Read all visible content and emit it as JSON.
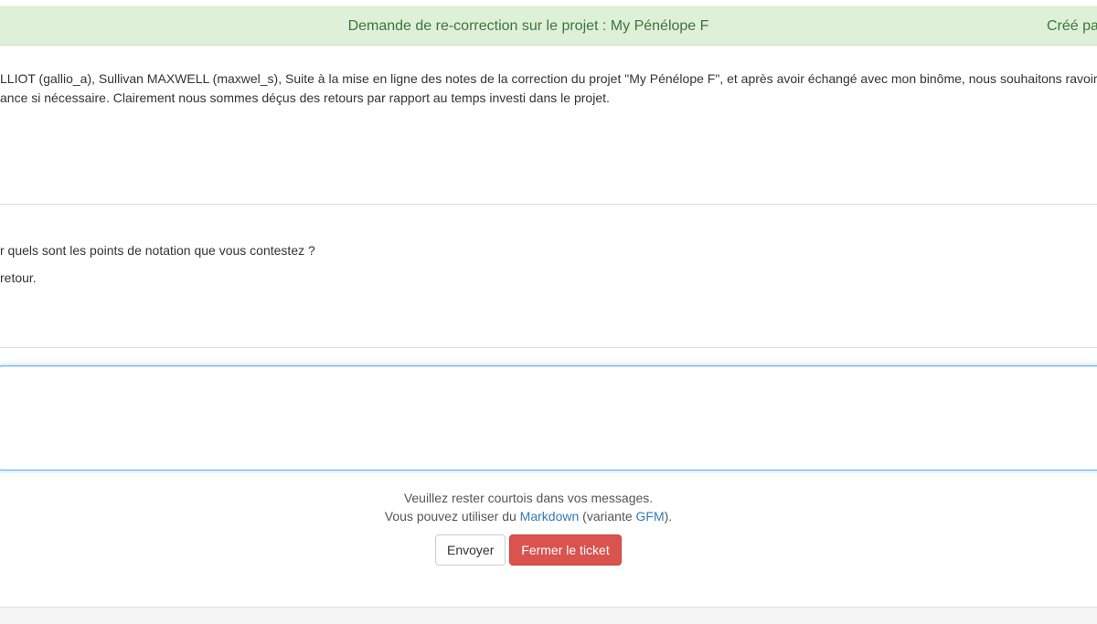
{
  "ticket": {
    "title": "Demande de re-correction sur le projet : My Pénélope F",
    "author_prefix": "Créé pa"
  },
  "messages": [
    {
      "line1": "LLIOT (gallio_a), Sullivan MAXWELL (maxwel_s), Suite à la mise en ligne des notes de la correction du projet \"My Pénélope F\", et après avoir échangé avec mon binôme, nous souhaitons ravoir",
      "line2": "ance si nécessaire. Clairement nous sommes déçus des retours par rapport au temps investi dans le projet."
    },
    {
      "line1": "r quels sont les points de notation que vous contestez ?",
      "line2": "retour."
    }
  ],
  "reply": {
    "value": "",
    "placeholder": ""
  },
  "hints": {
    "courtesy": "Veuillez rester courtois dans vos messages.",
    "markdown_prefix": "Vous pouvez utiliser du ",
    "markdown_link": "Markdown",
    "variant_prefix": " (variante ",
    "gfm_link": "GFM",
    "variant_suffix": ")."
  },
  "buttons": {
    "send": "Envoyer",
    "close": "Fermer le ticket"
  },
  "colors": {
    "header_bg": "#dff0d8",
    "header_text": "#3c763d",
    "link": "#337ab7",
    "danger": "#d9534f"
  }
}
